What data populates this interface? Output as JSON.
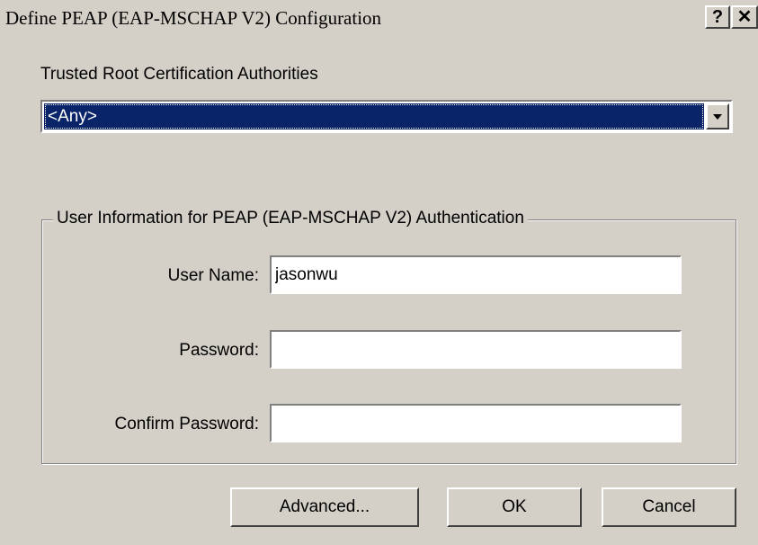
{
  "window": {
    "title": "Define PEAP (EAP-MSCHAP V2) Configuration",
    "help_label": "?",
    "close_label": "✕"
  },
  "trusted_ca": {
    "label": "Trusted Root Certification Authorities",
    "selected": "<Any>"
  },
  "user_info": {
    "group_label": "User Information for PEAP (EAP-MSCHAP V2) Authentication",
    "username_label": "User Name:",
    "username_value": "jasonwu",
    "password_label": "Password:",
    "password_value": "",
    "confirm_label": "Confirm Password:",
    "confirm_value": ""
  },
  "buttons": {
    "advanced": "Advanced...",
    "ok": "OK",
    "cancel": "Cancel"
  }
}
